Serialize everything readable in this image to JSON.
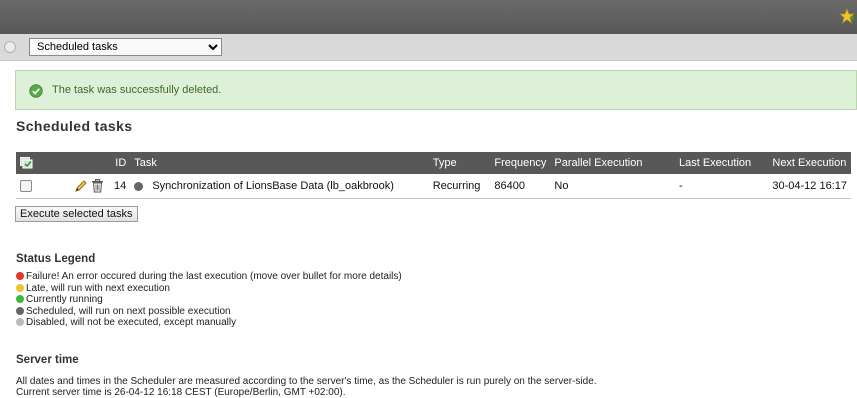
{
  "module_menu": {
    "selected": "Scheduled tasks"
  },
  "flash": {
    "message": "The task was successfully deleted."
  },
  "page_title": "Scheduled tasks",
  "table": {
    "headers": {
      "id": "ID",
      "task": "Task",
      "type": "Type",
      "frequency": "Frequency",
      "parallel": "Parallel Execution",
      "last": "Last Execution",
      "next": "Next Execution"
    },
    "rows": [
      {
        "id": "14",
        "task": "Synchronization of LionsBase Data (lb_oakbrook)",
        "type": "Recurring",
        "frequency": "86400",
        "parallel": "No",
        "last": "-",
        "next": "30-04-12 16:17",
        "status_color": "#666666"
      }
    ]
  },
  "execute_button": "Execute selected tasks",
  "legend": {
    "title": "Status Legend",
    "items": [
      {
        "text": "Failure! An error occured during the last execution (move over bullet for more details)",
        "color": "#e0382a"
      },
      {
        "text": "Late, will run with next execution",
        "color": "#f2c12e"
      },
      {
        "text": "Currently running",
        "color": "#3cb83c"
      },
      {
        "text": "Scheduled, will run on next possible execution",
        "color": "#666666"
      },
      {
        "text": "Disabled, will not be executed, except manually",
        "color": "#bbbbbb"
      }
    ]
  },
  "server_time": {
    "title": "Server time",
    "line1": "All dates and times in the Scheduler are measured according to the server's time, as the Scheduler is run purely on the server-side.",
    "line2": "Current server time is 26-04-12 16:18 CEST (Europe/Berlin, GMT +02:00)."
  },
  "colors": {
    "topbar": "#5f5f5f",
    "flash_bg": "#dff0d8",
    "table_header": "#585858"
  }
}
